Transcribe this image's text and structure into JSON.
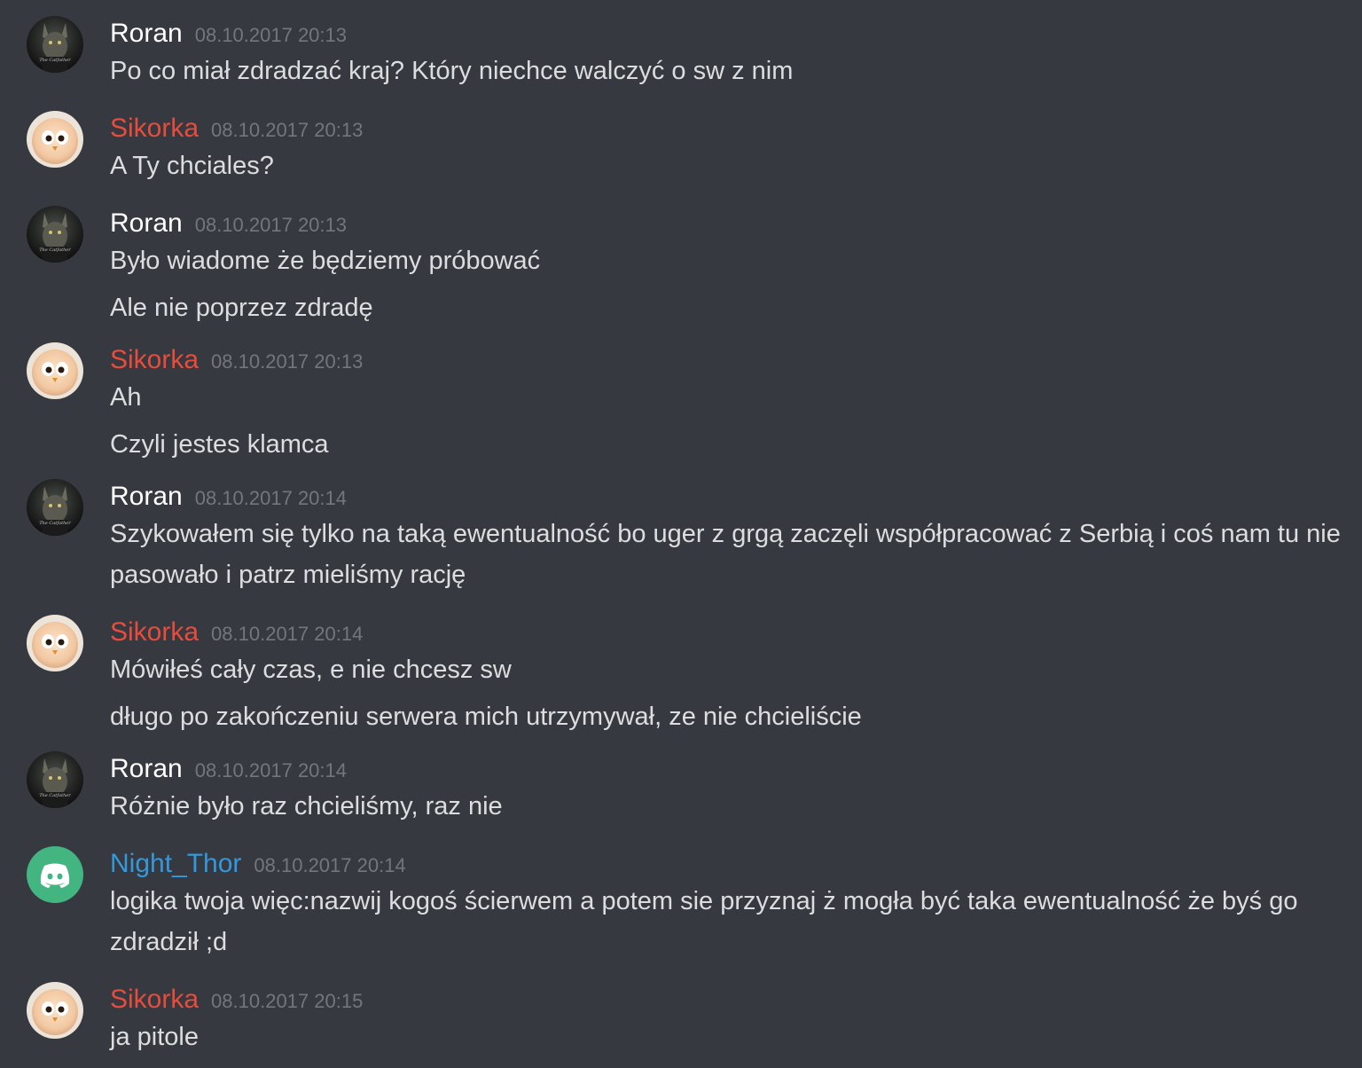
{
  "colors": {
    "background": "#36393f",
    "text": "#dcddde",
    "timestamp": "#72767d",
    "roran": "#ffffff",
    "sikorka": "#e74c3c",
    "night_thor": "#3498db",
    "default_avatar": "#43b581"
  },
  "messages": [
    {
      "author": "Roran",
      "avatar": "catfather-avatar",
      "avatar_text": "The Catfather",
      "timestamp": "08.10.2017 20:13",
      "lines": [
        "Po co miał zdradzać kraj? Który niechce walczyć o sw z nim"
      ]
    },
    {
      "author": "Sikorka",
      "avatar": "bird-avatar",
      "timestamp": "08.10.2017 20:13",
      "lines": [
        "A Ty chciales?"
      ]
    },
    {
      "author": "Roran",
      "avatar": "catfather-avatar",
      "avatar_text": "The Catfather",
      "timestamp": "08.10.2017 20:13",
      "lines": [
        "Było wiadome że będziemy próbować",
        "Ale nie poprzez zdradę"
      ]
    },
    {
      "author": "Sikorka",
      "avatar": "bird-avatar",
      "timestamp": "08.10.2017 20:13",
      "lines": [
        "Ah",
        "Czyli jestes klamca"
      ]
    },
    {
      "author": "Roran",
      "avatar": "catfather-avatar",
      "avatar_text": "The Catfather",
      "timestamp": "08.10.2017 20:14",
      "lines": [
        "Szykowałem się tylko na taką ewentualność bo uger z grgą zaczęli współpracować z Serbią i coś nam tu nie pasowało i patrz mieliśmy rację"
      ]
    },
    {
      "author": "Sikorka",
      "avatar": "bird-avatar",
      "timestamp": "08.10.2017 20:14",
      "lines": [
        "Mówiłeś cały czas, e nie chcesz sw",
        "długo po zakończeniu serwera mich utrzymywał, ze nie chcieliście"
      ]
    },
    {
      "author": "Roran",
      "avatar": "catfather-avatar",
      "avatar_text": "The Catfather",
      "timestamp": "08.10.2017 20:14",
      "lines": [
        "Różnie było raz chcieliśmy, raz nie"
      ]
    },
    {
      "author": "Night_Thor",
      "avatar": "discord-logo-avatar",
      "timestamp": "08.10.2017 20:14",
      "lines": [
        "logika twoja więc:nazwij kogoś ścierwem a potem sie przyznaj ż mogła być taka ewentualność że byś go zdradził ;d"
      ]
    },
    {
      "author": "Sikorka",
      "avatar": "bird-avatar",
      "timestamp": "08.10.2017 20:15",
      "lines": [
        "ja pitole"
      ]
    }
  ]
}
